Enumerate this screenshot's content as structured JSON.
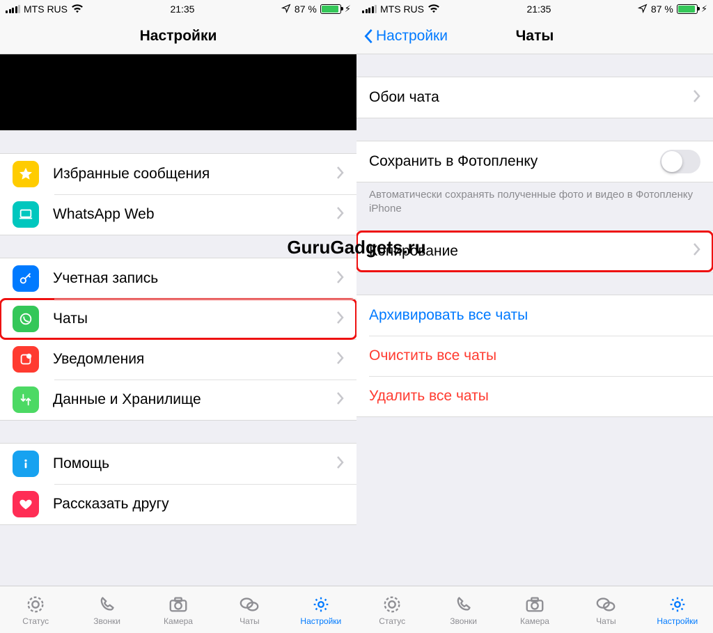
{
  "status": {
    "carrier": "MTS RUS",
    "time": "21:35",
    "battery_pct": "87 %"
  },
  "watermark": "GuruGadgets.ru",
  "left": {
    "title": "Настройки",
    "group1": [
      {
        "icon": "star",
        "label": "Избранные сообщения",
        "color": "yellow"
      },
      {
        "icon": "laptop",
        "label": "WhatsApp Web",
        "color": "teal"
      }
    ],
    "group2": [
      {
        "icon": "key",
        "label": "Учетная запись",
        "color": "blue"
      },
      {
        "icon": "whatsapp",
        "label": "Чаты",
        "color": "green",
        "highlight": true
      },
      {
        "icon": "bell",
        "label": "Уведомления",
        "color": "orange"
      },
      {
        "icon": "data",
        "label": "Данные и Хранилище",
        "color": "green2"
      }
    ],
    "group3": [
      {
        "icon": "info",
        "label": "Помощь",
        "color": "lblue"
      },
      {
        "icon": "heart",
        "label": "Рассказать другу",
        "color": "red"
      }
    ]
  },
  "right": {
    "back": "Настройки",
    "title": "Чаты",
    "wallpaper": "Обои чата",
    "save_to_camera": "Сохранить в Фотопленку",
    "save_note": "Автоматически сохранять полученные фото и видео в Фотопленку iPhone",
    "copy": "Копирование",
    "archive_all": "Архивировать все чаты",
    "clear_all": "Очистить все чаты",
    "delete_all": "Удалить все чаты"
  },
  "tabs": {
    "status": "Статус",
    "calls": "Звонки",
    "camera": "Камера",
    "chats": "Чаты",
    "settings": "Настройки"
  }
}
